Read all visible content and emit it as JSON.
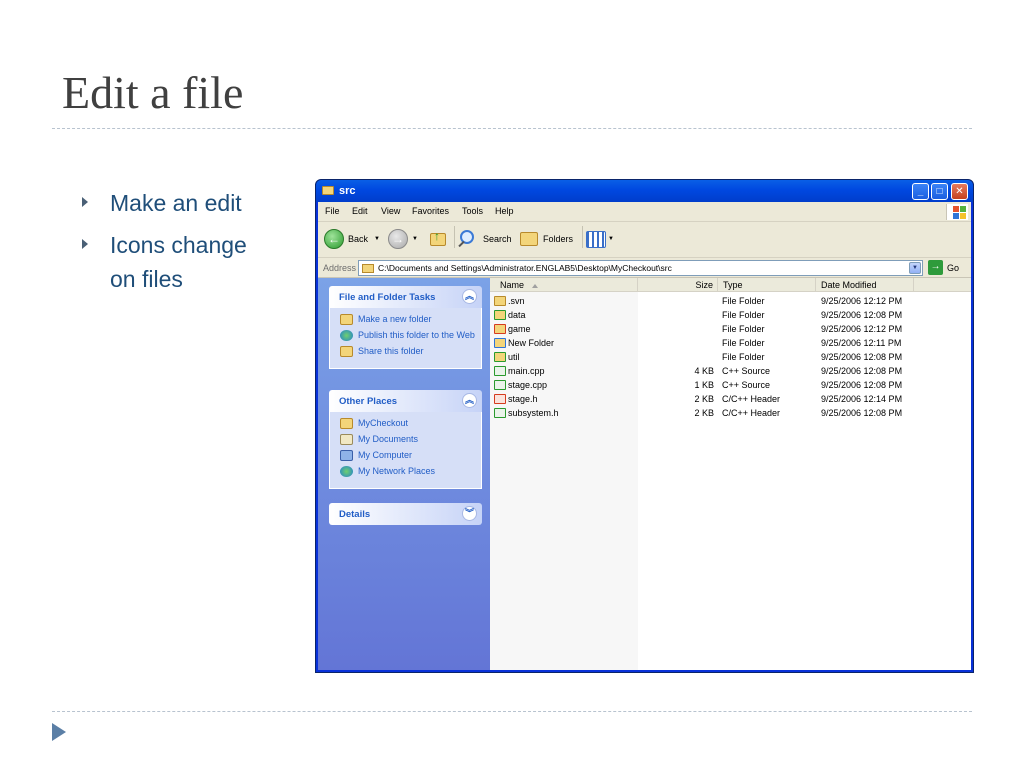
{
  "slide": {
    "title": "Edit a file",
    "bullets": [
      "Make an edit",
      "Icons change on files"
    ]
  },
  "window": {
    "title": "src",
    "menu": [
      "File",
      "Edit",
      "View",
      "Favorites",
      "Tools",
      "Help"
    ],
    "toolbar": {
      "back_label": "Back",
      "search_label": "Search",
      "folders_label": "Folders"
    },
    "address": {
      "label": "Address",
      "value": "C:\\Documents and Settings\\Administrator.ENGLAB5\\Desktop\\MyCheckout\\src",
      "go_label": "Go"
    },
    "taskpane": {
      "file_tasks": {
        "title": "File and Folder Tasks",
        "items": [
          "Make a new folder",
          "Publish this folder to the Web",
          "Share this folder"
        ]
      },
      "other_places": {
        "title": "Other Places",
        "items": [
          "MyCheckout",
          "My Documents",
          "My Computer",
          "My Network Places"
        ]
      },
      "details": {
        "title": "Details"
      }
    },
    "columns": {
      "name": "Name",
      "size": "Size",
      "type": "Type",
      "date": "Date Modified"
    },
    "files": [
      {
        "name": ".svn",
        "size": "",
        "type": "File Folder",
        "date": "9/25/2006 12:12 PM",
        "icon": "folder-icon"
      },
      {
        "name": "data",
        "size": "",
        "type": "File Folder",
        "date": "9/25/2006 12:08 PM",
        "icon": "svn-folder-modified-icon"
      },
      {
        "name": "game",
        "size": "",
        "type": "File Folder",
        "date": "9/25/2006 12:12 PM",
        "icon": "svn-folder-conflict-icon"
      },
      {
        "name": "New Folder",
        "size": "",
        "type": "File Folder",
        "date": "9/25/2006 12:11 PM",
        "icon": "svn-folder-added-icon"
      },
      {
        "name": "util",
        "size": "",
        "type": "File Folder",
        "date": "9/25/2006 12:08 PM",
        "icon": "svn-folder-modified-icon"
      },
      {
        "name": "main.cpp",
        "size": "4 KB",
        "type": "C++ Source",
        "date": "9/25/2006 12:08 PM",
        "icon": "svn-file-normal-icon"
      },
      {
        "name": "stage.cpp",
        "size": "1 KB",
        "type": "C++ Source",
        "date": "9/25/2006 12:08 PM",
        "icon": "svn-file-normal-icon"
      },
      {
        "name": "stage.h",
        "size": "2 KB",
        "type": "C/C++ Header",
        "date": "9/25/2006 12:14 PM",
        "icon": "svn-file-modified-icon"
      },
      {
        "name": "subsystem.h",
        "size": "2 KB",
        "type": "C/C++ Header",
        "date": "9/25/2006 12:08 PM",
        "icon": "svn-file-normal-icon"
      }
    ]
  }
}
